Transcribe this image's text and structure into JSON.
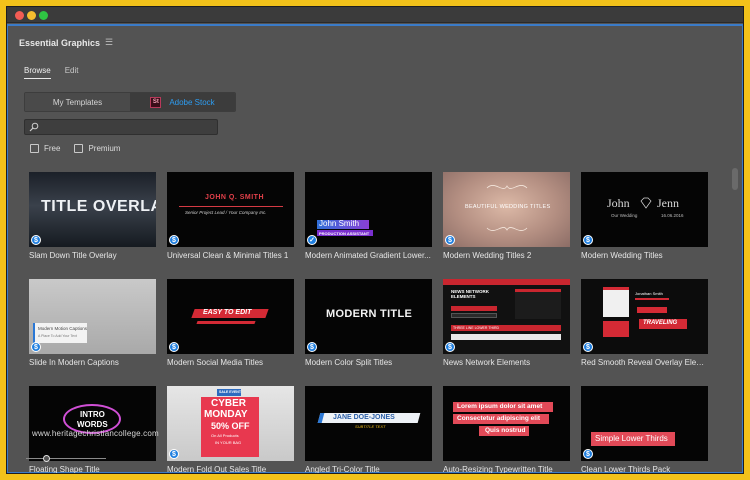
{
  "panel": {
    "title": "Essential Graphics",
    "menu_icon": "hamburger-menu-icon"
  },
  "tabs": [
    {
      "label": "Browse",
      "active": true
    },
    {
      "label": "Edit",
      "active": false
    }
  ],
  "source": {
    "my_templates": "My Templates",
    "stock_badge": "St",
    "adobe_stock": "Adobe Stock"
  },
  "search": {
    "value": "",
    "placeholder": ""
  },
  "filters": {
    "free": "Free",
    "premium": "Premium"
  },
  "templates": [
    {
      "label": "Slam Down Title Overlay",
      "badge": "$",
      "thumb_text": "TITLE OVERLAY"
    },
    {
      "label": "Universal Clean & Minimal Titles 1",
      "badge": "$",
      "thumb_title": "JOHN Q. SMITH",
      "thumb_sub": "Senior Project Lead / Your Company Inc."
    },
    {
      "label": "Modern Animated Gradient Lower...",
      "badge": "check",
      "thumb_title": "John Smith",
      "thumb_sub": "PRODUCTION ASSISTANT"
    },
    {
      "label": "Modern Wedding Titles 2",
      "badge": "$",
      "thumb_title": "BEAUTIFUL WEDDING TITLES"
    },
    {
      "label": "Modern Wedding Titles",
      "badge": "$",
      "thumb_left": "John",
      "thumb_right": "Jenn",
      "thumb_sub": "Our Wedding",
      "thumb_date": "16.06.2016"
    },
    {
      "label": "Slide In Modern Captions",
      "badge": "$",
      "thumb_title": "Modern Motion Captions",
      "thumb_sub": "A Place To Add Your Text"
    },
    {
      "label": "Modern Social Media Titles",
      "badge": "$",
      "thumb_title": "EASY TO EDIT"
    },
    {
      "label": "Modern Color Split Titles",
      "badge": "$",
      "thumb_title": "MODERN TITLE"
    },
    {
      "label": "News Network Elements",
      "badge": "$",
      "thumb_title": "NEWS NETWORK ELEMENTS",
      "thumb_sub": "THREE LINE LOWER THIRD"
    },
    {
      "label": "Red Smooth Reveal Overlay Elem...",
      "badge": "$",
      "thumb_title": "TRAVELING",
      "thumb_sub": "Jonathan Smith"
    },
    {
      "label": "Floating Shape Title",
      "badge": "",
      "thumb_title": "INTRO",
      "thumb_sub": "WORDS"
    },
    {
      "label": "Modern Fold Out Sales Title",
      "badge": "$",
      "thumb_tag": "SALE EVENT",
      "thumb_title": "CYBER",
      "thumb_title2": "MONDAY",
      "thumb_sub": "50% OFF",
      "thumb_sub2": "On All Products",
      "thumb_sub3": "IN YOUR BAG"
    },
    {
      "label": "Angled Tri-Color Title",
      "badge": "",
      "thumb_title": "JANE DOE-JONES",
      "thumb_sub": "SUBTITLE TEXT"
    },
    {
      "label": "Auto-Resizing Typewritten Title",
      "badge": "",
      "thumb_lines": [
        "Lorem ipsum dolor sit amet",
        "Consectetur adipiscing elit",
        "Quis nostrud"
      ]
    },
    {
      "label": "Clean Lower Thirds Pack",
      "badge": "$",
      "thumb_title": "Simple Lower Thirds"
    }
  ],
  "watermark": "www.heritagechristiancollege.com",
  "zoom": {
    "level": 0.25
  },
  "colors": {
    "accent": "#2d9cf0",
    "panel": "#535353",
    "frame": "#f2c21a",
    "red": "#d82c3c"
  }
}
